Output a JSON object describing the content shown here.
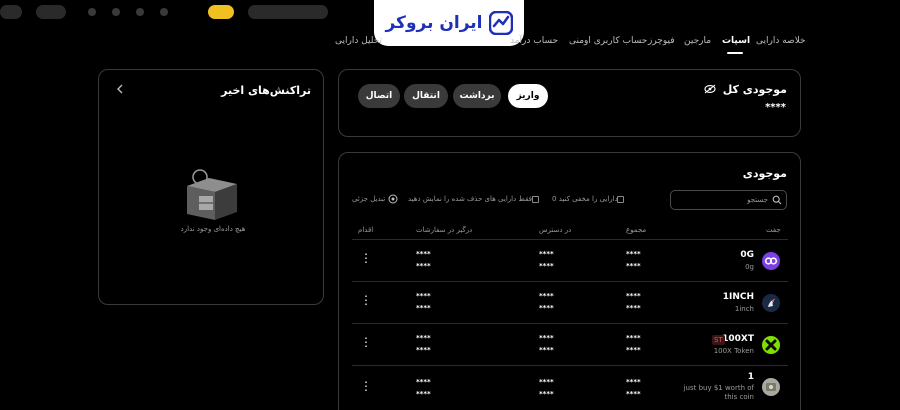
{
  "logo": {
    "text": "ایران بروکر"
  },
  "nav": {
    "items": [
      "خلاصه دارایی",
      "اسپات",
      "مارجین",
      "فیوچرز",
      "حساب کاربری اومنی",
      "حساب درآمد",
      "تحلیل دارایی"
    ],
    "active": "اسپات"
  },
  "total_balance": {
    "title": "موجودی کل",
    "value": "****",
    "buttons": {
      "deposit": "واریز",
      "withdraw": "برداشت",
      "transfer": "انتقال",
      "connect": "اتصال"
    }
  },
  "recent_transactions": {
    "title": "تراکنش‌های اخیر",
    "empty_text": "هیچ داده‌ای وجود ندارد"
  },
  "balances": {
    "title": "موجودی",
    "search_placeholder": "جستجو",
    "hide_zero": "0 دارایی را مخفی کنید",
    "show_delisted": "فقط دارایی های حذف شده را نمایش دهید",
    "small_convert": "تبدیل جزئی",
    "columns": {
      "pair": "جفت",
      "total": "مجموع",
      "available": "در دسترس",
      "in_orders": "درگیر در سفارشات",
      "action": "اقدام"
    },
    "rows": [
      {
        "name": "0G",
        "sub": "0g",
        "badge": "",
        "total_a": "****",
        "total_b": "****",
        "avail_a": "****",
        "avail_b": "****",
        "orders_a": "****",
        "orders_b": "****",
        "icon_color": "#7b3fe4"
      },
      {
        "name": "1INCH",
        "sub": "1inch",
        "badge": "",
        "total_a": "****",
        "total_b": "****",
        "avail_a": "****",
        "avail_b": "****",
        "orders_a": "****",
        "orders_b": "****",
        "icon_color": "#1b2a44"
      },
      {
        "name": "100XT",
        "sub": "100X Token",
        "badge": "ST",
        "total_a": "****",
        "total_b": "****",
        "avail_a": "****",
        "avail_b": "****",
        "orders_a": "****",
        "orders_b": "****",
        "icon_color": "#7ee000"
      },
      {
        "name": "1",
        "sub": "just buy $1 worth of this coin",
        "badge": "",
        "total_a": "****",
        "total_b": "****",
        "avail_a": "****",
        "avail_b": "****",
        "orders_a": "****",
        "orders_b": "****",
        "icon_color": "#a9a9a0"
      }
    ]
  }
}
